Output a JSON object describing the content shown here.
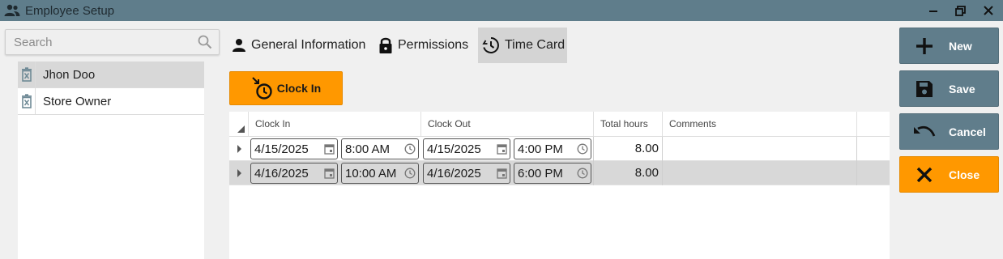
{
  "window": {
    "title": "Employee Setup",
    "icons": {
      "app": "people-icon",
      "minimize": "minimize-icon",
      "restore": "restore-icon",
      "close": "close-icon"
    }
  },
  "search": {
    "placeholder": "Search",
    "icon": "search-icon"
  },
  "employees": [
    {
      "name": "Jhon Doo",
      "selected": true
    },
    {
      "name": "Store Owner",
      "selected": false
    }
  ],
  "tabs": [
    {
      "label": "General Information",
      "icon": "person-icon",
      "active": false
    },
    {
      "label": "Permissions",
      "icon": "lock-icon",
      "active": false
    },
    {
      "label": "Time Card",
      "icon": "clock-history-icon",
      "active": true
    }
  ],
  "clock_in_button": {
    "label": "Clock In",
    "icon": "clock-in-icon"
  },
  "grid": {
    "columns": [
      "Clock In",
      "Clock Out",
      "Total hours",
      "Comments"
    ],
    "rows": [
      {
        "clock_in_date": "4/15/2025",
        "clock_in_time": "8:00 AM",
        "clock_out_date": "4/15/2025",
        "clock_out_time": "4:00 PM",
        "total_hours": "8.00",
        "comments": ""
      },
      {
        "clock_in_date": "4/16/2025",
        "clock_in_time": "10:00 AM",
        "clock_out_date": "4/16/2025",
        "clock_out_time": "6:00 PM",
        "total_hours": "8.00",
        "comments": ""
      }
    ]
  },
  "actions": {
    "new": "New",
    "save": "Save",
    "cancel": "Cancel",
    "close": "Close"
  },
  "colors": {
    "titlebar": "#5f7d8b",
    "action_gray": "#607d8b",
    "accent_orange": "#ff9800"
  }
}
